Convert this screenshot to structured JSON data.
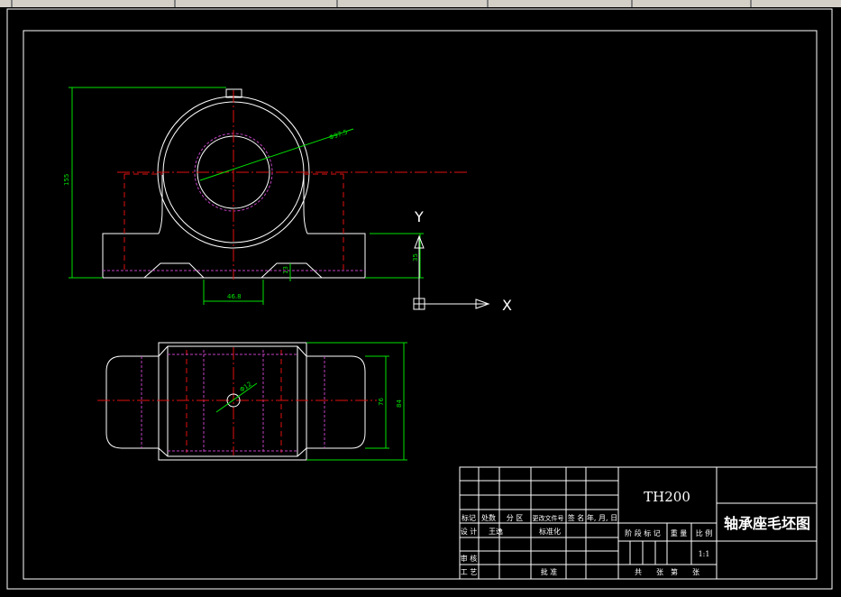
{
  "drawing": {
    "part_code": "TH200",
    "part_name": "轴承座毛坯图",
    "scale": "1:1"
  },
  "ucs": {
    "x_label": "X",
    "y_label": "Y"
  },
  "dimensions": {
    "diameter": "Φ97.5",
    "height_total": "155",
    "base_offset": "35",
    "foot_height": "13",
    "slot_width": "46.8",
    "bolt_hole": "Φ12",
    "width_inner": "76",
    "width_outer": "84"
  },
  "title_block": {
    "row_labels": [
      "标记",
      "处数",
      "分 区",
      "更改文件号",
      "签 名",
      "年, 月, 日"
    ],
    "designer_label": "设 计",
    "designer_name": "王逸",
    "standardize_label": "标准化",
    "review_label": "审 核",
    "process_label": "工 艺",
    "approve_label": "批 准",
    "stage_label": "阶 段 标 记",
    "weight_label": "重 量",
    "scale_label": "比 例",
    "sheets_label": "共　　张　第　　张"
  },
  "colors": {
    "background": "#000000",
    "outline": "#ffffff",
    "centerline": "#e01010",
    "dimension": "#00e000",
    "hidden": "#c040c0"
  }
}
